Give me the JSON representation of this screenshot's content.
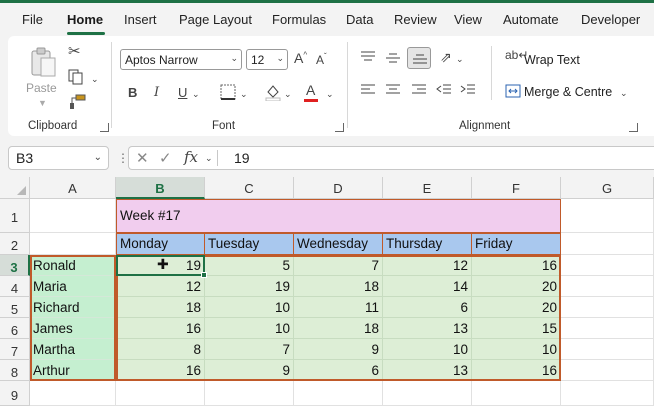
{
  "menu": {
    "tabs": [
      "File",
      "Home",
      "Insert",
      "Page Layout",
      "Formulas",
      "Data",
      "Review",
      "View",
      "Automate",
      "Developer"
    ],
    "active": "Home"
  },
  "ribbon": {
    "clipboard": {
      "label": "Clipboard",
      "paste_label": "Paste"
    },
    "font": {
      "label": "Font",
      "font_name": "Aptos Narrow",
      "font_size": "12"
    },
    "alignment": {
      "label": "Alignment",
      "wrap_text": "Wrap Text",
      "merge_centre": "Merge & Centre"
    }
  },
  "formula_bar": {
    "name_box": "B3",
    "fx": "fx",
    "value": "19"
  },
  "sheet": {
    "columns": [
      "A",
      "B",
      "C",
      "D",
      "E",
      "F",
      "G"
    ],
    "rows": [
      "1",
      "2",
      "3",
      "4",
      "5",
      "6",
      "7",
      "8",
      "9"
    ],
    "selected_column": "B",
    "selected_row": "3",
    "title": "Week #17",
    "days": [
      "Monday",
      "Tuesday",
      "Wednesday",
      "Thursday",
      "Friday"
    ],
    "people": [
      {
        "name": "Ronald",
        "values": [
          19,
          5,
          7,
          12,
          16
        ]
      },
      {
        "name": "Maria",
        "values": [
          12,
          19,
          18,
          14,
          20
        ]
      },
      {
        "name": "Richard",
        "values": [
          18,
          10,
          11,
          6,
          20
        ]
      },
      {
        "name": "James",
        "values": [
          16,
          10,
          18,
          13,
          15
        ]
      },
      {
        "name": "Martha",
        "values": [
          8,
          7,
          9,
          10,
          10
        ]
      },
      {
        "name": "Arthur",
        "values": [
          16,
          9,
          6,
          13,
          16
        ]
      }
    ]
  },
  "colors": {
    "excel_green": "#1e7145",
    "title_fill": "#f1cdee",
    "header_fill": "#a9c8ee",
    "name_fill": "#c5efd0",
    "data_fill": "#ddeed6",
    "table_border": "#c05a2a"
  }
}
